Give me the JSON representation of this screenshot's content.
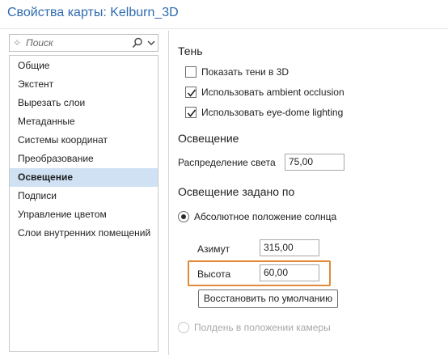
{
  "window": {
    "title": "Свойства карты: Kelburn_3D"
  },
  "search": {
    "placeholder": "Поиск"
  },
  "sidebar": {
    "items": [
      {
        "label": "Общие"
      },
      {
        "label": "Экстент"
      },
      {
        "label": "Вырезать слои"
      },
      {
        "label": "Метаданные"
      },
      {
        "label": "Системы координат"
      },
      {
        "label": "Преобразование"
      },
      {
        "label": "Освещение",
        "selected": true
      },
      {
        "label": "Подписи"
      },
      {
        "label": "Управление цветом"
      },
      {
        "label": "Слои внутренних помещений"
      }
    ]
  },
  "shadow": {
    "heading": "Тень",
    "options": [
      {
        "label": "Показать тени в 3D",
        "checked": false
      },
      {
        "label": "Использовать ambient occlusion",
        "checked": true
      },
      {
        "label": "Использовать eye-dome lighting",
        "checked": true
      }
    ]
  },
  "lighting": {
    "heading": "Освещение",
    "distribution_label": "Распределение света",
    "distribution_value": "75,00"
  },
  "lighting_by": {
    "heading": "Освещение задано по",
    "absolute_label": "Абсолютное положение солнца",
    "absolute_selected": true,
    "azimuth_label": "Азимут",
    "azimuth_value": "315,00",
    "altitude_label": "Высота",
    "altitude_value": "60,00",
    "reset_label": "Восстановить по умолчанию",
    "camera_label": "Полдень в положении камеры",
    "camera_enabled": false
  },
  "colors": {
    "accent": "#2e6bb0",
    "highlight": "#e08a3a",
    "selection": "#cfe1f3"
  }
}
